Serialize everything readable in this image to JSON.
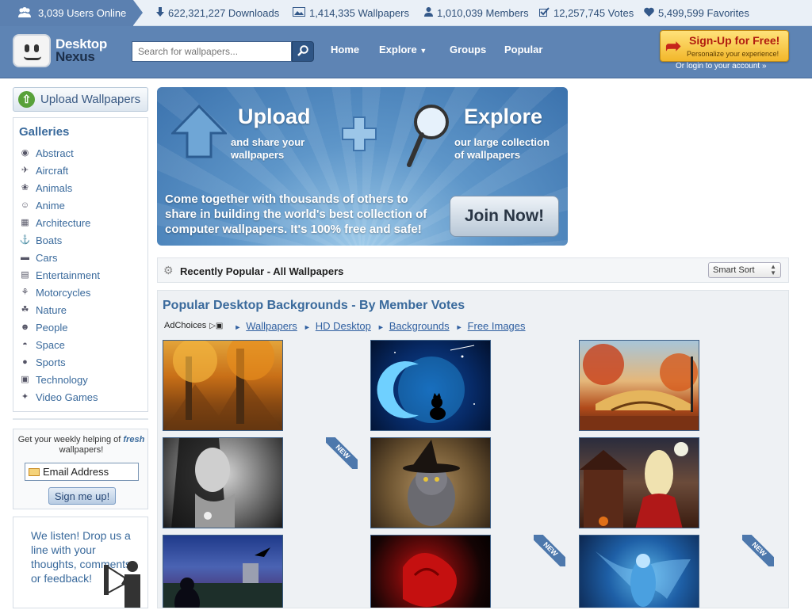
{
  "stats": {
    "online": "3,039 Users Online",
    "downloads": "622,321,227 Downloads",
    "wallpapers": "1,414,335 Wallpapers",
    "members": "1,010,039 Members",
    "votes": "12,257,745 Votes",
    "favorites": "5,499,599 Favorites"
  },
  "header": {
    "logo_line1": "Desktop",
    "logo_line2": "Nexus",
    "search_placeholder": "Search for wallpapers...",
    "nav": [
      "Home",
      "Explore",
      "Groups",
      "Popular"
    ],
    "signup_title": "Sign-Up for Free!",
    "signup_sub": "Personalize your experience!",
    "login": "Or login to your account »"
  },
  "sidebar": {
    "upload": "Upload Wallpapers",
    "galleries_title": "Galleries",
    "galleries": [
      {
        "label": "Abstract",
        "icon": "eye-icon"
      },
      {
        "label": "Aircraft",
        "icon": "plane-icon"
      },
      {
        "label": "Animals",
        "icon": "animal-icon"
      },
      {
        "label": "Anime",
        "icon": "anime-icon"
      },
      {
        "label": "Architecture",
        "icon": "building-icon"
      },
      {
        "label": "Boats",
        "icon": "anchor-icon"
      },
      {
        "label": "Cars",
        "icon": "car-icon"
      },
      {
        "label": "Entertainment",
        "icon": "film-icon"
      },
      {
        "label": "Motorcycles",
        "icon": "motorcycle-icon"
      },
      {
        "label": "Nature",
        "icon": "leaf-icon"
      },
      {
        "label": "People",
        "icon": "person-icon"
      },
      {
        "label": "Space",
        "icon": "ufo-icon"
      },
      {
        "label": "Sports",
        "icon": "ball-icon"
      },
      {
        "label": "Technology",
        "icon": "monitor-icon"
      },
      {
        "label": "Video Games",
        "icon": "gamepad-icon"
      }
    ],
    "newsletter_pre": "Get your weekly helping of",
    "newsletter_em": "fresh",
    "newsletter_post": "wallpapers!",
    "email_placeholder": "Email Address",
    "signme": "Sign me up!",
    "feedback": "We listen! Drop us a line with your thoughts, comments, or feedback!"
  },
  "banner": {
    "upload_title": "Upload",
    "upload_sub1": "and share your",
    "upload_sub2": "wallpapers",
    "explore_title": "Explore",
    "explore_sub1": "our large collection",
    "explore_sub2": "of wallpapers",
    "body_l1": "Come together with thousands of others to",
    "body_l2": "share in building the world's best collection of",
    "body_l3": "computer wallpapers. It's 100% free and safe!",
    "join": "Join Now!"
  },
  "recent": {
    "title": "Recently Popular - All Wallpapers",
    "sort": "Smart Sort"
  },
  "popular": {
    "title": "Popular Desktop Backgrounds - By Member Votes",
    "adchoices": "AdChoices",
    "adlinks": [
      "Wallpapers",
      "HD Desktop",
      "Backgrounds",
      "Free Images"
    ],
    "new_label": "NEW"
  }
}
